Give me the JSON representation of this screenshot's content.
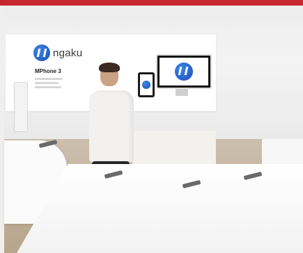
{
  "photo": {
    "signboard": {
      "brand": "ngaku",
      "product": "MPhone 3"
    },
    "colors": {
      "top_strip": "#c8262e",
      "logo_blue": "#1c4fb8"
    }
  }
}
